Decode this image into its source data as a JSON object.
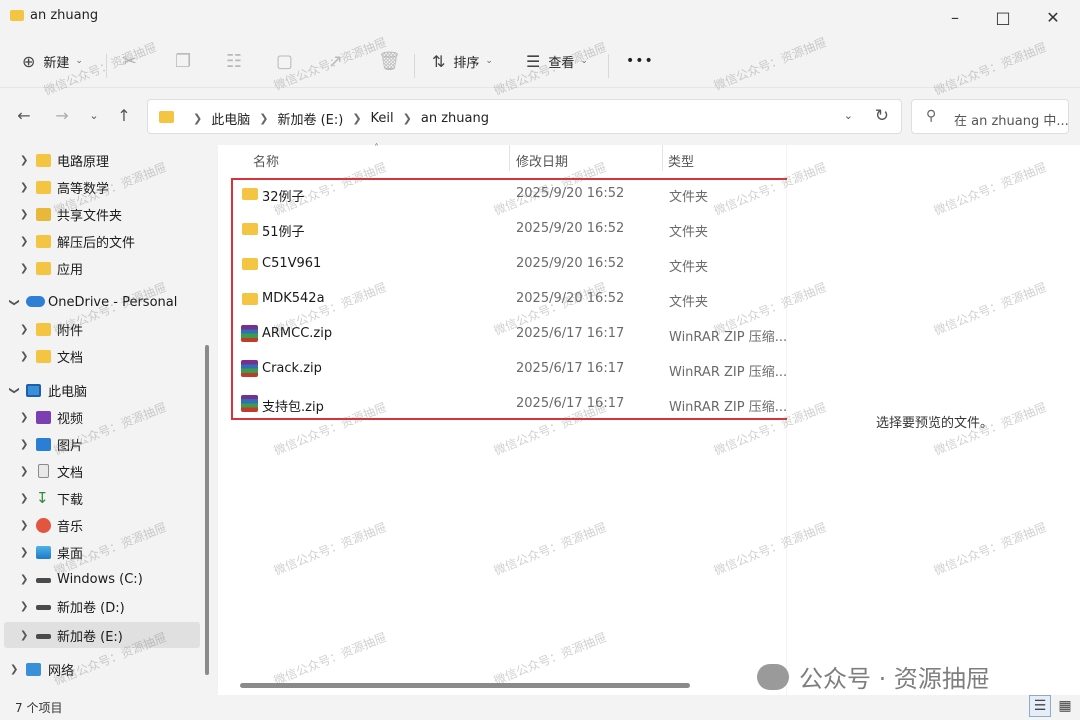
{
  "window": {
    "title": "an zhuang"
  },
  "toolbar": {
    "new_label": "新建",
    "sort_label": "排序",
    "view_label": "查看",
    "more_label": "•••"
  },
  "address": {
    "crumbs": [
      "此电脑",
      "新加卷 (E:)",
      "Keil",
      "an zhuang"
    ]
  },
  "search": {
    "placeholder": "在 an zhuang 中..."
  },
  "sidebar": {
    "items": [
      {
        "label": "电路原理",
        "icon": "folder-icon"
      },
      {
        "label": "高等数学",
        "icon": "folder-icon"
      },
      {
        "label": "共享文件夹",
        "icon": "shared-folder-icon"
      },
      {
        "label": "解压后的文件",
        "icon": "folder-icon"
      },
      {
        "label": "应用",
        "icon": "folder-icon"
      },
      {
        "label": "OneDrive - Personal",
        "icon": "cloud-icon"
      },
      {
        "label": "附件",
        "icon": "folder-icon"
      },
      {
        "label": "文档",
        "icon": "folder-icon"
      },
      {
        "label": "此电脑",
        "icon": "computer-icon"
      },
      {
        "label": "视频",
        "icon": "video-icon"
      },
      {
        "label": "图片",
        "icon": "picture-icon"
      },
      {
        "label": "文档",
        "icon": "document-icon"
      },
      {
        "label": "下载",
        "icon": "download-icon"
      },
      {
        "label": "音乐",
        "icon": "music-icon"
      },
      {
        "label": "桌面",
        "icon": "desktop-icon"
      },
      {
        "label": "Windows (C:)",
        "icon": "drive-icon"
      },
      {
        "label": "新加卷 (D:)",
        "icon": "drive-icon"
      },
      {
        "label": "新加卷 (E:)",
        "icon": "drive-icon"
      },
      {
        "label": "网络",
        "icon": "network-icon"
      }
    ]
  },
  "columns": {
    "name": "名称",
    "date": "修改日期",
    "type": "类型"
  },
  "files": [
    {
      "name": "32例子",
      "date": "2025/9/20 16:52",
      "type": "文件夹",
      "kind": "folder"
    },
    {
      "name": "51例子",
      "date": "2025/9/20 16:52",
      "type": "文件夹",
      "kind": "folder"
    },
    {
      "name": "C51V961",
      "date": "2025/9/20 16:52",
      "type": "文件夹",
      "kind": "folder"
    },
    {
      "name": "MDK542a",
      "date": "2025/9/20 16:52",
      "type": "文件夹",
      "kind": "folder"
    },
    {
      "name": "ARMCC.zip",
      "date": "2025/6/17 16:17",
      "type": "WinRAR ZIP 压缩...",
      "kind": "zip"
    },
    {
      "name": "Crack.zip",
      "date": "2025/6/17 16:17",
      "type": "WinRAR ZIP 压缩...",
      "kind": "zip"
    },
    {
      "name": "支持包.zip",
      "date": "2025/6/17 16:17",
      "type": "WinRAR ZIP 压缩...",
      "kind": "zip"
    }
  ],
  "preview": {
    "text": "选择要预览的文件。"
  },
  "status": {
    "count": "7 个项目"
  },
  "watermark": {
    "small": "微信公众号：资源抽屉",
    "big": "公众号 · 资源抽屉"
  }
}
